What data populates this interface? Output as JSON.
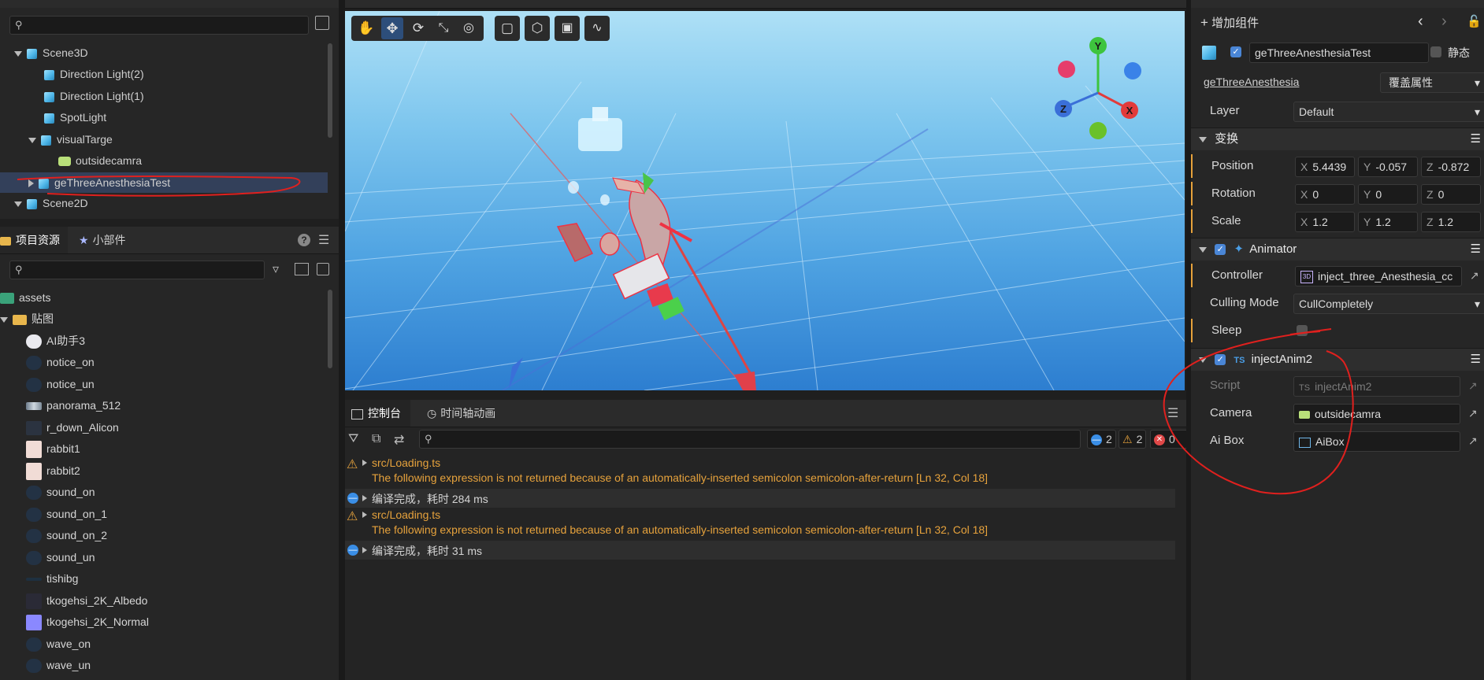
{
  "hierarchy": {
    "search_placeholder": "",
    "nodes": [
      "Scene3D",
      "Direction Light(2)",
      "Direction Light(1)",
      "SpotLight",
      "visualTarge",
      "outsidecamra",
      "geThreeAnesthesiaTest",
      "Scene2D"
    ]
  },
  "assets_panel": {
    "tab_project": "项目资源",
    "tab_widgets": "小部件",
    "help": "?",
    "items": [
      "assets",
      "贴图",
      "AI助手3",
      "notice_on",
      "notice_un",
      "panorama_512",
      "r_down_Alicon",
      "rabbit1",
      "rabbit2",
      "sound_on",
      "sound_on_1",
      "sound_on_2",
      "sound_un",
      "tishibg",
      "tkogehsi_2K_Albedo",
      "tkogehsi_2K_Normal",
      "wave_on",
      "wave_un"
    ]
  },
  "console": {
    "tab_console": "控制台",
    "tab_timeline": "时间轴动画",
    "count_info": "2",
    "count_warn": "2",
    "count_error": "0",
    "entries": [
      {
        "type": "warn",
        "file": "src/Loading.ts",
        "message": "The following expression is not returned because of an automatically-inserted semicolon semicolon-after-return [Ln 32, Col 18]"
      },
      {
        "type": "info",
        "message": "编译完成，耗时 284 ms"
      },
      {
        "type": "warn",
        "file": "src/Loading.ts",
        "message": "The following expression is not returned because of an automatically-inserted semicolon semicolon-after-return [Ln 32, Col 18]"
      },
      {
        "type": "info",
        "message": "编译完成，耗时 31 ms"
      }
    ]
  },
  "inspector": {
    "add_component": "增加组件",
    "node_name": "geThreeAnesthesiaTest",
    "static_label": "静态",
    "prefab_link": "geThreeAnesthesia",
    "override_label": "覆盖属性",
    "layer_label": "Layer",
    "layer_value": "Default",
    "transform": {
      "title": "变换",
      "position_label": "Position",
      "px": "5.4439",
      "py": "-0.057",
      "pz": "-0.872",
      "rotation_label": "Rotation",
      "rx": "0",
      "ry": "0",
      "rz": "0",
      "scale_label": "Scale",
      "sx": "1.2",
      "sy": "1.2",
      "sz": "1.2"
    },
    "animator": {
      "title": "Animator",
      "controller_label": "Controller",
      "controller_value": "inject_three_Anesthesia_cc",
      "culling_label": "Culling Mode",
      "culling_value": "CullCompletely",
      "sleep_label": "Sleep"
    },
    "script": {
      "title": "injectAnim2",
      "script_label": "Script",
      "script_value": "injectAnim2",
      "camera_label": "Camera",
      "camera_value": "outsidecamra",
      "aibox_label": "Ai Box",
      "aibox_value": "AiBox"
    }
  },
  "axes": {
    "x": "X",
    "y": "Y",
    "z": "Z"
  },
  "colors": {
    "accent": "#4a86d6",
    "warn": "#e6a23c",
    "annotation": "#e0201e"
  }
}
